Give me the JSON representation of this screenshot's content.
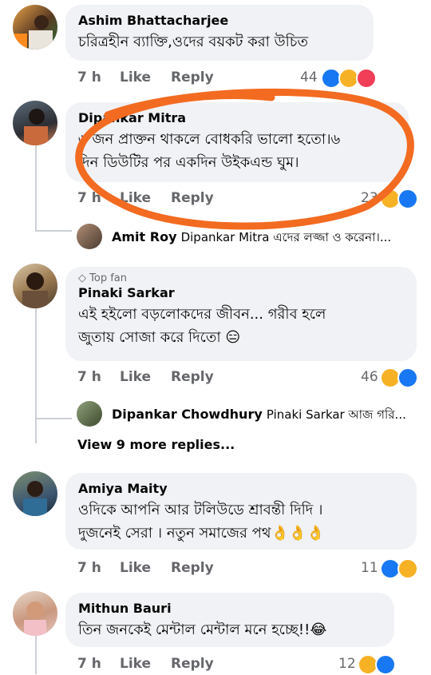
{
  "comments": [
    {
      "name": "Ashim Bhattacharjee",
      "lines": [
        "চরিত্রহীন ব্যাক্তি,ওদের বয়কট করা উচিত"
      ],
      "time": "7 h",
      "like": "Like",
      "reply": "Reply",
      "count": "44",
      "reactions": [
        "like",
        "haha",
        "love"
      ]
    },
    {
      "name": "Dipankar Mitra",
      "lines": [
        "৬ জন প্রাক্তন থাকলে বোধকরি ভালো হতো।৬",
        "দিন ডিউটির পর একদিন উইকএন্ড ঘুম।"
      ],
      "time": "7 h",
      "like": "Like",
      "reply": "Reply",
      "count": "23",
      "reactions": [
        "haha",
        "like"
      ],
      "reply_preview": {
        "name": "Amit Roy",
        "text": "Dipankar Mitra এদের লজ্জা ও করেনা।..."
      }
    },
    {
      "badge": "Top fan",
      "name": "Pinaki Sarkar",
      "lines": [
        "এই হইলো বড়লোকদের জীবন... গরীব হলে",
        "জুতায় সোজা করে দিতো 😑"
      ],
      "time": "7 h",
      "like": "Like",
      "reply": "Reply",
      "count": "46",
      "reactions": [
        "haha",
        "like"
      ],
      "reply_preview": {
        "name": "Dipankar Chowdhury",
        "text": "Pinaki Sarkar আজ গরি..."
      },
      "view_more": "View 9 more replies..."
    },
    {
      "name": "Amiya Maity",
      "lines": [
        "ওদিকে আপনি আর টলিউডে শ্রাবন্তী দিদি ।",
        "দুজনেই সেরা । নতুন সমাজের পথ👌👌👌"
      ],
      "time": "7 h",
      "like": "Like",
      "reply": "Reply",
      "count": "11",
      "reactions": [
        "like",
        "haha"
      ]
    },
    {
      "name": "Mithun Bauri",
      "lines": [
        "তিন জনকেই মেন্টাল মেন্টাল মনে হচ্ছে!!😂"
      ],
      "time": "7 h",
      "like": "Like",
      "reply": "Reply",
      "count": "12",
      "reactions": [
        "haha",
        "like"
      ]
    }
  ],
  "colors": {
    "bubble": "#f0f2f5",
    "meta": "#65676b",
    "like": "#1877f2",
    "haha": "#f7b125",
    "love": "#f33e58",
    "annotation": "#f26b21"
  }
}
